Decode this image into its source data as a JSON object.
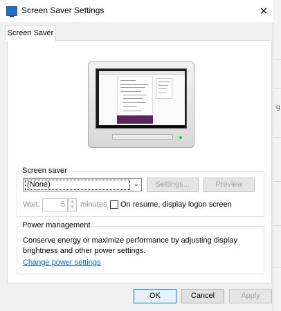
{
  "window": {
    "title": "Screen Saver Settings",
    "close_glyph": "✕"
  },
  "tabs": [
    {
      "label": "Screen Saver",
      "selected": true
    }
  ],
  "screen_saver": {
    "group_label": "Screen saver",
    "selected_option": "(None)",
    "settings_label": "Settings...",
    "preview_label": "Preview",
    "wait_label": "Wait:",
    "wait_value": "5",
    "minutes_label": "minutes",
    "resume_label": "On resume, display logon screen",
    "resume_checked": false
  },
  "power": {
    "group_label": "Power management",
    "description": "Conserve energy or maximize performance by adjusting display brightness and other power settings.",
    "link_label": "Change power settings"
  },
  "footer": {
    "ok_label": "OK",
    "cancel_label": "Cancel",
    "apply_label": "Apply"
  },
  "background_app": {
    "edge_chars": [
      "g"
    ]
  },
  "colors": {
    "accent": "#0078d7",
    "link": "#0066cc",
    "preview_band": "#5a2561",
    "led": "#28c828"
  }
}
